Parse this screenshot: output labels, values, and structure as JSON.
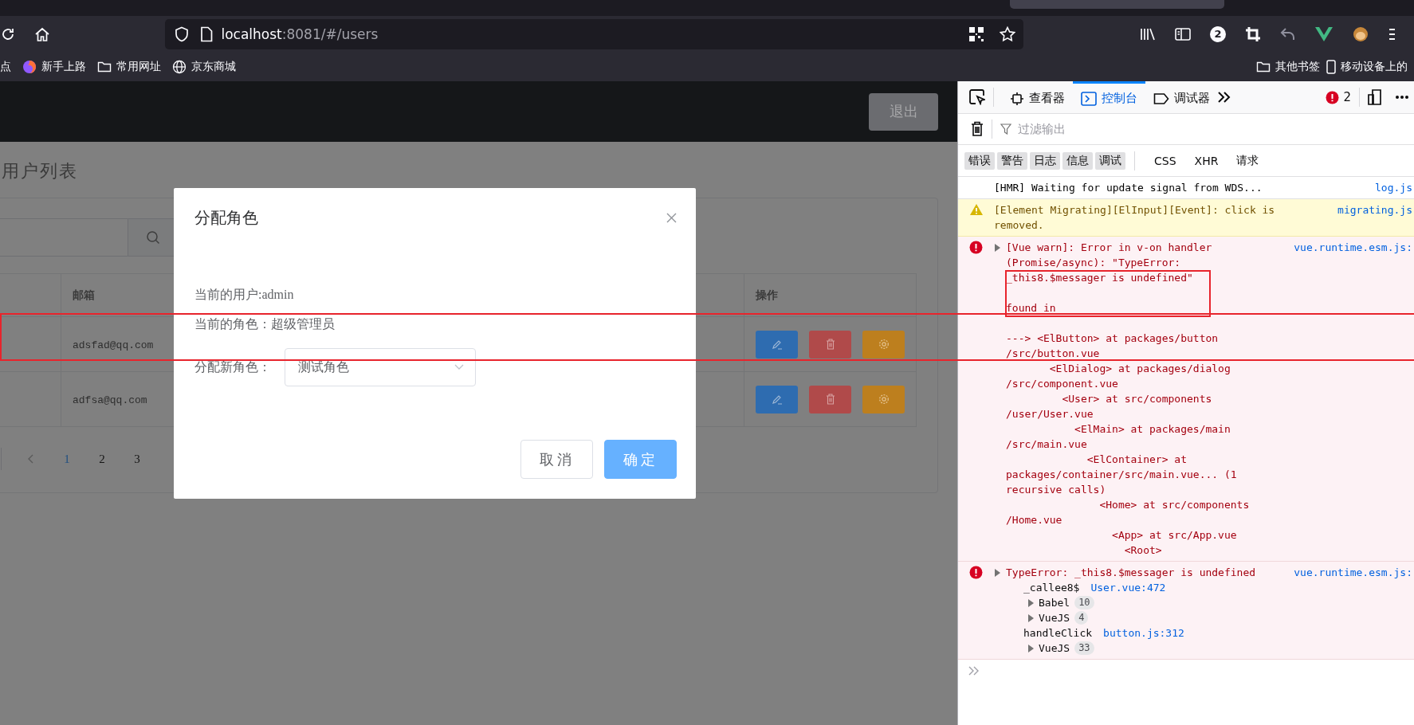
{
  "browser": {
    "url": {
      "host": "localhost",
      "path": ":8081/#/users"
    },
    "extension_badge": "2",
    "bookmarks": [
      {
        "label": "点",
        "kind": "plain"
      },
      {
        "label": "新手上路",
        "kind": "firefox"
      },
      {
        "label": "常用网址",
        "kind": "folder"
      },
      {
        "label": "京东商城",
        "kind": "globe"
      }
    ],
    "bookmarks_right": [
      {
        "label": "其他书签",
        "kind": "folder"
      },
      {
        "label": "移动设备上的",
        "kind": "phone"
      }
    ]
  },
  "app": {
    "logout_button": "退出",
    "page_title": "用户列表",
    "table": {
      "columns": [
        {
          "label": "邮箱"
        },
        {
          "label": "操作"
        }
      ],
      "rows": [
        {
          "email": "adsfad@qq.com"
        },
        {
          "email": "adfsa@qq.com"
        }
      ]
    },
    "pagination": [
      {
        "label": "1",
        "selected": true
      },
      {
        "label": "2",
        "selected": false
      },
      {
        "label": "3",
        "selected": false
      }
    ]
  },
  "dialog": {
    "title": "分配角色",
    "lines": [
      "当前的用户:admin",
      "当前的角色：超级管理员"
    ],
    "select": {
      "label": "分配新角色：",
      "value": "测试角色"
    },
    "buttons": [
      {
        "label": "取消",
        "kind": "default"
      },
      {
        "label": "确定",
        "kind": "primary"
      }
    ]
  },
  "devtools": {
    "tabs": [
      {
        "label": "查看器",
        "selected": false
      },
      {
        "label": "控制台",
        "selected": true
      },
      {
        "label": "调试器",
        "selected": false
      }
    ],
    "error_count": "2",
    "filter": {
      "placeholder": "过滤输出"
    },
    "categories": [
      {
        "label": "错误",
        "selected": true
      },
      {
        "label": "警告",
        "selected": true
      },
      {
        "label": "日志",
        "selected": true
      },
      {
        "label": "信息",
        "selected": true
      },
      {
        "label": "调试",
        "selected": true
      },
      {
        "label": "CSS",
        "selected": false
      },
      {
        "label": "XHR",
        "selected": false
      },
      {
        "label": "请求",
        "selected": false
      }
    ],
    "messages": [
      {
        "kind": "log",
        "source": "log.js",
        "paragraphs": [
          [
            "[HMR] Waiting for update signal from WDS..."
          ]
        ]
      },
      {
        "kind": "warning",
        "source": "migrating.js",
        "paragraphs": [
          [
            "[Element Migrating][ElInput][Event]: click is",
            "removed."
          ]
        ]
      },
      {
        "kind": "error",
        "source": "vue.runtime.esm.js:",
        "paragraphs": [
          [
            "[Vue warn]: Error in v-on handler",
            "(Promise/async): \"TypeError:",
            "_this8.$messager is undefined\""
          ],
          [
            "found in"
          ],
          [
            "---> <ElButton> at packages/button",
            "/src/button.vue",
            "       <ElDialog> at packages/dialog",
            "/src/component.vue",
            "         <User> at src/components",
            "/user/User.vue",
            "           <ElMain> at packages/main",
            "/src/main.vue",
            "             <ElContainer> at",
            "packages/container/src/main.vue... (1",
            "recursive calls)",
            "               <Home> at src/components",
            "/Home.vue",
            "                 <App> at src/App.vue",
            "                   <Root>"
          ]
        ]
      },
      {
        "kind": "error",
        "source": "vue.runtime.esm.js:",
        "paragraphs": [
          [
            "TypeError: _this8.$messager is undefined"
          ]
        ],
        "stack": [
          {
            "kind": "frame",
            "name": "_callee8$",
            "location": "User.vue:472"
          },
          {
            "kind": "group",
            "name": "Babel",
            "count": "10"
          },
          {
            "kind": "group",
            "name": "VueJS",
            "count": "4"
          },
          {
            "kind": "frame",
            "name": "handleClick",
            "location": "button.js:312"
          },
          {
            "kind": "group",
            "name": "VueJS",
            "count": "33"
          }
        ]
      }
    ]
  },
  "annotations": [
    {
      "kind": "box"
    },
    {
      "kind": "box"
    }
  ]
}
